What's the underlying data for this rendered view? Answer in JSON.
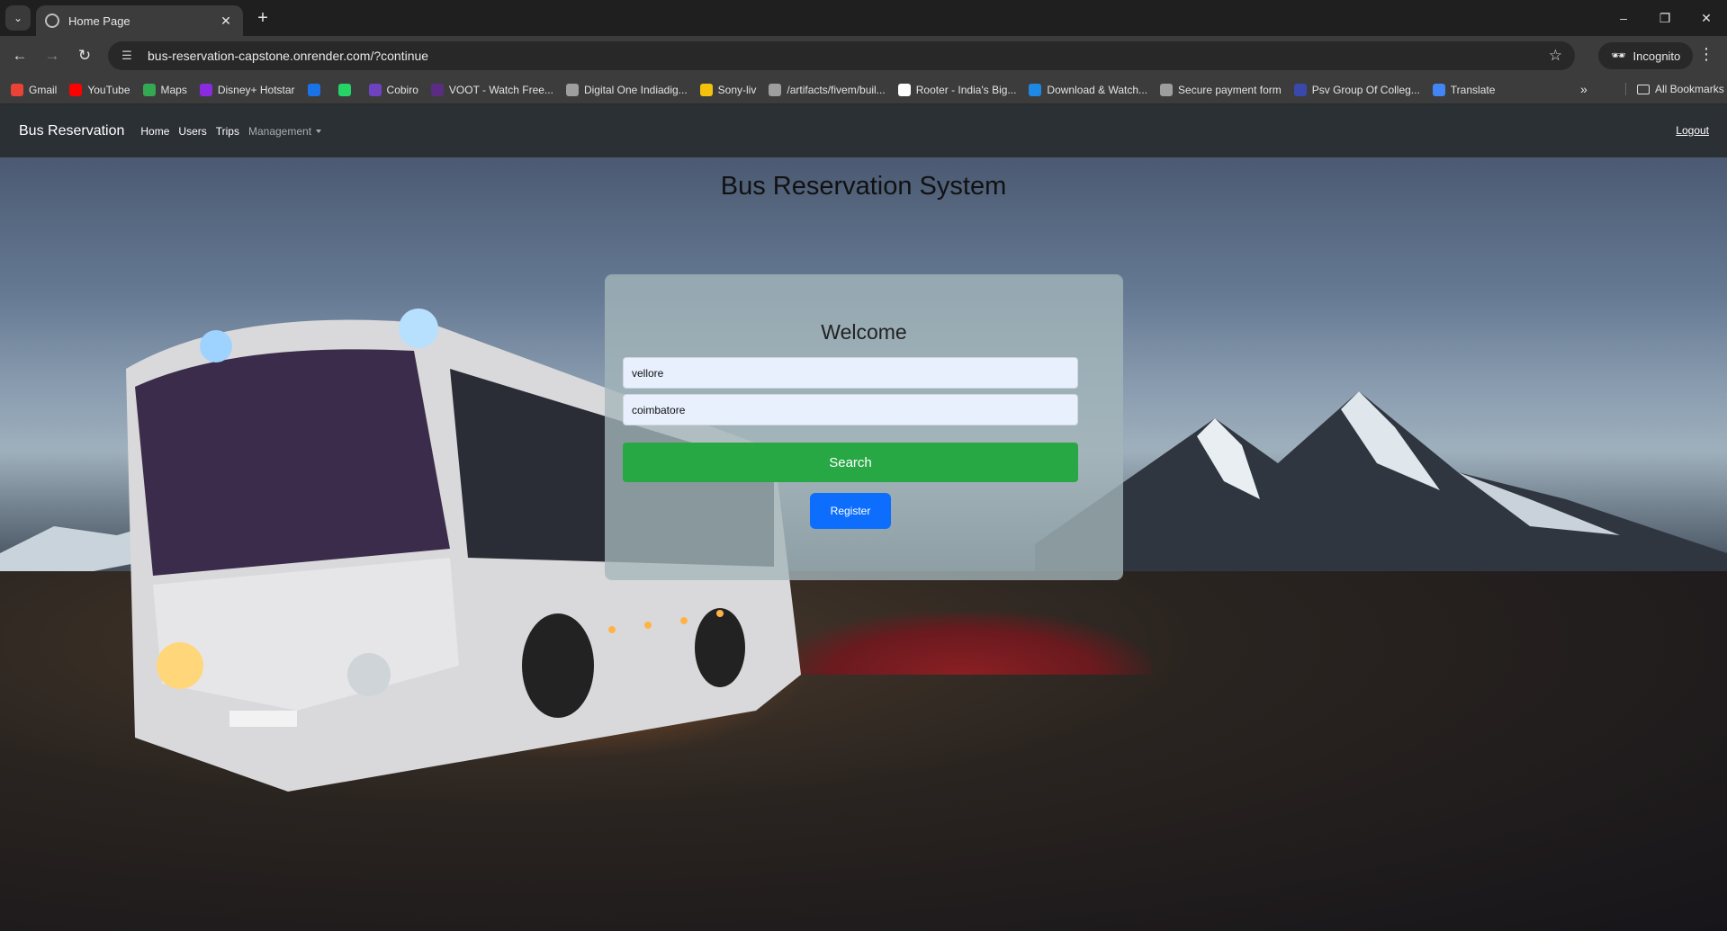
{
  "browser": {
    "tab_title": "Home Page",
    "url": "bus-reservation-capstone.onrender.com/?continue",
    "incognito_label": "Incognito",
    "bookmarks": [
      {
        "label": "Gmail",
        "color": "#ea4335"
      },
      {
        "label": "YouTube",
        "color": "#ff0000"
      },
      {
        "label": "Maps",
        "color": "#34a853"
      },
      {
        "label": "Disney+ Hotstar",
        "color": "#8a2be2"
      },
      {
        "label": "",
        "color": "#1a73e8"
      },
      {
        "label": "",
        "color": "#25d366"
      },
      {
        "label": "Cobiro",
        "color": "#6f42c1"
      },
      {
        "label": "VOOT - Watch Free...",
        "color": "#5b2c83"
      },
      {
        "label": "Digital One Indiadig...",
        "color": "#9e9e9e"
      },
      {
        "label": "Sony-liv",
        "color": "#f4c20d"
      },
      {
        "label": "/artifacts/fivem/buil...",
        "color": "#9e9e9e"
      },
      {
        "label": "Rooter - India's Big...",
        "color": "#ffffff"
      },
      {
        "label": "Download & Watch...",
        "color": "#1e88e5"
      },
      {
        "label": "Secure payment form",
        "color": "#9e9e9e"
      },
      {
        "label": "Psv Group Of Colleg...",
        "color": "#3949ab"
      },
      {
        "label": "Translate",
        "color": "#4285f4"
      }
    ],
    "all_bookmarks_label": "All Bookmarks"
  },
  "navbar": {
    "brand": "Bus Reservation",
    "links": [
      "Home",
      "Users",
      "Trips"
    ],
    "management_label": "Management",
    "logout_label": "Logout"
  },
  "page": {
    "title": "Bus Reservation System",
    "card_heading": "Welcome",
    "from_value": "vellore",
    "to_value": "coimbatore",
    "search_label": "Search",
    "register_label": "Register"
  },
  "colors": {
    "search_button": "#28a745",
    "register_button": "#0d6efd",
    "navbar": "#2b3035"
  }
}
